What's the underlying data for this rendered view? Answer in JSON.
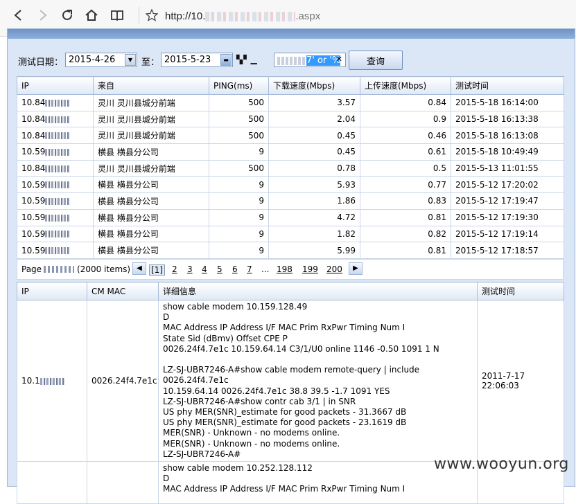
{
  "browser": {
    "url_prefix": "http://10.",
    "url_suffix": ".aspx"
  },
  "filter": {
    "date_label": "测试日期：",
    "start_date": "2015-4-26",
    "to_label": "至：",
    "end_date": "2015-5-23",
    "search_text": "7' or '%",
    "query_button": "查询"
  },
  "speed_table": {
    "headers": [
      "IP",
      "来自",
      "PING(ms)",
      "下载速度(Mbps)",
      "上传速度(Mbps)",
      "测试时间"
    ],
    "rows": [
      {
        "ip": "10.84",
        "from": "灵川 灵川县城分前端",
        "ping": "500",
        "down": "3.57",
        "up": "0.84",
        "time": "2015-5-18 16:14:00"
      },
      {
        "ip": "10.84",
        "from": "灵川 灵川县城分前端",
        "ping": "500",
        "down": "2.04",
        "up": "0.9",
        "time": "2015-5-18 16:13:38"
      },
      {
        "ip": "10.84",
        "from": "灵川 灵川县城分前端",
        "ping": "500",
        "down": "0.45",
        "up": "0.46",
        "time": "2015-5-18 16:13:08"
      },
      {
        "ip": "10.59",
        "from": "横县 横县分公司",
        "ping": "9",
        "down": "0.45",
        "up": "0.61",
        "time": "2015-5-18 10:49:49"
      },
      {
        "ip": "10.84",
        "from": "灵川 灵川县城分前端",
        "ping": "500",
        "down": "0.78",
        "up": "0.5",
        "time": "2015-5-13 11:01:55"
      },
      {
        "ip": "10.59",
        "from": "横县 横县分公司",
        "ping": "9",
        "down": "5.93",
        "up": "0.77",
        "time": "2015-5-12 17:20:02"
      },
      {
        "ip": "10.59",
        "from": "横县 横县分公司",
        "ping": "9",
        "down": "1.86",
        "up": "0.83",
        "time": "2015-5-12 17:19:47"
      },
      {
        "ip": "10.59",
        "from": "横县 横县分公司",
        "ping": "9",
        "down": "4.72",
        "up": "0.81",
        "time": "2015-5-12 17:19:30"
      },
      {
        "ip": "10.59",
        "from": "横县 横县分公司",
        "ping": "9",
        "down": "1.82",
        "up": "0.82",
        "time": "2015-5-12 17:19:14"
      },
      {
        "ip": "10.59",
        "from": "横县 横县分公司",
        "ping": "9",
        "down": "5.99",
        "up": "0.81",
        "time": "2015-5-12 17:18:57"
      }
    ]
  },
  "pager": {
    "page_label": "Page",
    "items": "(2000 items)",
    "current": "[1]",
    "pages": [
      "2",
      "3",
      "4",
      "5",
      "6",
      "7",
      "...",
      "198",
      "199",
      "200"
    ]
  },
  "modem_table": {
    "headers": [
      "IP",
      "CM MAC",
      "详细信息",
      "测试时间"
    ],
    "rows": [
      {
        "ip": "10.1",
        "mac": "0026.24f4.7e1c",
        "detail": "show cable modem 10.159.128.49\nD\nMAC Address IP Address I/F MAC Prim RxPwr Timing Num I\nState Sid (dBmv) Offset CPE P\n0026.24f4.7e1c 10.159.64.14 C3/1/U0 online 1146 -0.50 1091 1 N\n\nLZ-SJ-UBR7246-A#show cable modem remote-query | include 0026.24f4.7e1c\n10.159.64.14 0026.24f4.7e1c 38.8 39.5 -1.7 1091 YES\nLZ-SJ-UBR7246-A#show contr cab 3/1 | in SNR\nUS phy MER(SNR)_estimate for good packets - 31.3667 dB\nUS phy MER(SNR)_estimate for good packets - 23.1619 dB\nMER(SNR) - Unknown - no modems online.\nMER(SNR) - Unknown - no modems online.\nLZ-SJ-UBR7246-A#",
        "time": "2011-7-17 22:06:03"
      },
      {
        "ip": "",
        "mac": "",
        "detail": "show cable modem 10.252.128.112\nD\nMAC Address IP Address I/F MAC Prim RxPwr Timing Num I",
        "time": ""
      }
    ]
  },
  "watermark": "www.wooyun.org"
}
